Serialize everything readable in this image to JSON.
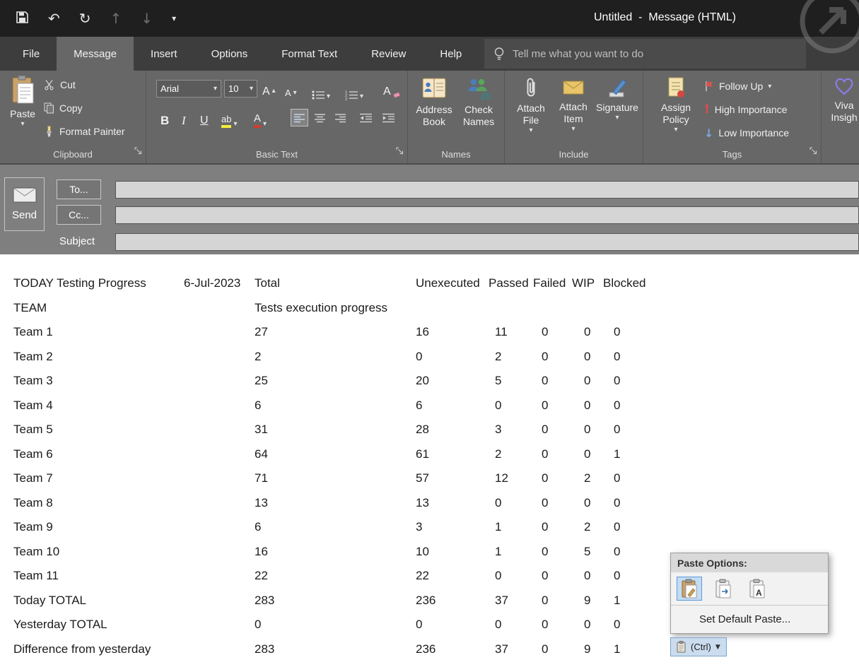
{
  "colors": {
    "titlebar_bg": "#1f1f1f",
    "tabrow_bg": "#3d3d3d",
    "ribbon_bg": "#676767",
    "envelope_bg": "#7f7f7f",
    "flag_red": "#d85450",
    "importance_high_red": "#e8474d",
    "importance_low_blue": "#79abde",
    "highlight_yellow": "#f3ed39",
    "font_color_red": "#d23b2e",
    "paste_selected_blue": "#c4dcf3"
  },
  "icons": {
    "undo": "↶",
    "redo": "↻",
    "arrow_up": "↑",
    "arrow_down": "↓",
    "caret_down": "▾",
    "caret_down_filled": "▼",
    "tri_up": "▴"
  },
  "titlebar": {
    "title": "Untitled  -  Message (HTML)"
  },
  "tabs": {
    "items": [
      "File",
      "Message",
      "Insert",
      "Options",
      "Format Text",
      "Review",
      "Help"
    ],
    "selected": "Message"
  },
  "tell_me": {
    "placeholder": "Tell me what you want to do"
  },
  "ribbon": {
    "clipboard": {
      "group": "Clipboard",
      "paste": "Paste",
      "cut": "Cut",
      "copy": "Copy",
      "format_painter": "Format Painter"
    },
    "basic_text": {
      "group": "Basic Text",
      "font_name": "Arial",
      "font_size": "10",
      "bold": "B",
      "italic": "I",
      "underline": "U",
      "highlight": "ab",
      "font_color": "A",
      "grow": "A",
      "shrink": "A",
      "clear": "A"
    },
    "names": {
      "group": "Names",
      "address_book": "Address Book",
      "check_names": "Check Names"
    },
    "include": {
      "group": "Include",
      "attach_file": "Attach File",
      "attach_item": "Attach Item",
      "signature": "Signature"
    },
    "tags": {
      "group": "Tags",
      "assign_policy": "Assign Policy",
      "follow_up": "Follow Up",
      "high_importance": "High Importance",
      "low_importance": "Low Importance"
    },
    "viva": {
      "label": "Viva Insigh"
    }
  },
  "envelope": {
    "send": "Send",
    "to": "To...",
    "cc": "Cc...",
    "subject": "Subject",
    "to_value": "",
    "cc_value": "",
    "subject_value": ""
  },
  "message": {
    "header": {
      "title": "TODAY Testing Progress",
      "date": "6-Jul-2023",
      "total": "Total",
      "unexecuted": "Unexecuted",
      "passed": "Passed",
      "failed": "Failed",
      "wip": "WIP",
      "blocked": "Blocked"
    },
    "subheader": {
      "team": "TEAM",
      "caption": "Tests execution progress"
    },
    "rows": [
      {
        "name": "Team 1",
        "total": "27",
        "unexecuted": "16",
        "passed": "11",
        "failed": "0",
        "wip": "0",
        "blocked": "0"
      },
      {
        "name": "Team 2",
        "total": "2",
        "unexecuted": "0",
        "passed": "2",
        "failed": "0",
        "wip": "0",
        "blocked": "0"
      },
      {
        "name": "Team 3",
        "total": "25",
        "unexecuted": "20",
        "passed": "5",
        "failed": "0",
        "wip": "0",
        "blocked": "0"
      },
      {
        "name": "Team 4",
        "total": "6",
        "unexecuted": "6",
        "passed": "0",
        "failed": "0",
        "wip": "0",
        "blocked": "0"
      },
      {
        "name": "Team 5",
        "total": "31",
        "unexecuted": "28",
        "passed": "3",
        "failed": "0",
        "wip": "0",
        "blocked": "0"
      },
      {
        "name": "Team 6",
        "total": "64",
        "unexecuted": "61",
        "passed": "2",
        "failed": "0",
        "wip": "0",
        "blocked": "1"
      },
      {
        "name": "Team 7",
        "total": "71",
        "unexecuted": "57",
        "passed": "12",
        "failed": "0",
        "wip": "2",
        "blocked": "0"
      },
      {
        "name": "Team 8",
        "total": "13",
        "unexecuted": "13",
        "passed": "0",
        "failed": "0",
        "wip": "0",
        "blocked": "0"
      },
      {
        "name": "Team 9",
        "total": "6",
        "unexecuted": "3",
        "passed": "1",
        "failed": "0",
        "wip": "2",
        "blocked": "0"
      },
      {
        "name": "Team 10",
        "total": "16",
        "unexecuted": "10",
        "passed": "1",
        "failed": "0",
        "wip": "5",
        "blocked": "0"
      },
      {
        "name": "Team 11",
        "total": "22",
        "unexecuted": "22",
        "passed": "0",
        "failed": "0",
        "wip": "0",
        "blocked": "0"
      },
      {
        "name": "Today TOTAL",
        "total": "283",
        "unexecuted": "236",
        "passed": "37",
        "failed": "0",
        "wip": "9",
        "blocked": "1"
      },
      {
        "name": "Yesterday TOTAL",
        "total": "0",
        "unexecuted": "0",
        "passed": "0",
        "failed": "0",
        "wip": "0",
        "blocked": "0"
      },
      {
        "name": "Difference from yesterday",
        "total": "283",
        "unexecuted": "236",
        "passed": "37",
        "failed": "0",
        "wip": "9",
        "blocked": "1"
      }
    ]
  },
  "paste_popup": {
    "title": "Paste Options:",
    "set_default": "Set Default Paste...",
    "ctrl": "(Ctrl)"
  }
}
